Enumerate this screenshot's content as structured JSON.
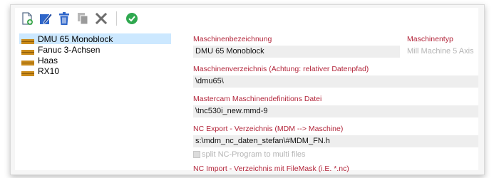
{
  "toolbar": {
    "icons": [
      "new-file-icon",
      "edit-icon",
      "delete-icon",
      "copy-icon",
      "close-icon",
      "confirm-icon"
    ]
  },
  "tree": {
    "items": [
      {
        "label": "DMU 65 Monoblock",
        "selected": true
      },
      {
        "label": "Fanuc 3-Achsen",
        "selected": false
      },
      {
        "label": "Haas",
        "selected": false
      },
      {
        "label": "RX10",
        "selected": false
      }
    ]
  },
  "form": {
    "machine_name_label": "Maschinenbezeichnung",
    "machine_name_value": "DMU 65 Monoblock",
    "machine_type_label": "Maschinentyp",
    "machine_type_value": "Mill Machine 5 Axis",
    "machine_dir_label": "Maschinenverzeichnis (Achtung: relativer Datenpfad)",
    "machine_dir_value": "\\dmu65\\",
    "mastercam_def_label": "Mastercam Maschinendefinitions Datei",
    "mastercam_def_value": "\\tnc530i_new.mmd-9",
    "nc_export_label": "NC Export - Verzeichnis (MDM --> Maschine)",
    "nc_export_value": "s:\\mdm_nc_daten_stefan\\#MDM_FN.h",
    "split_label": "split NC-Program to multi files",
    "nc_import_label": "NC Import - Verzeichnis mit FileMask (i.E.  *.nc)"
  }
}
